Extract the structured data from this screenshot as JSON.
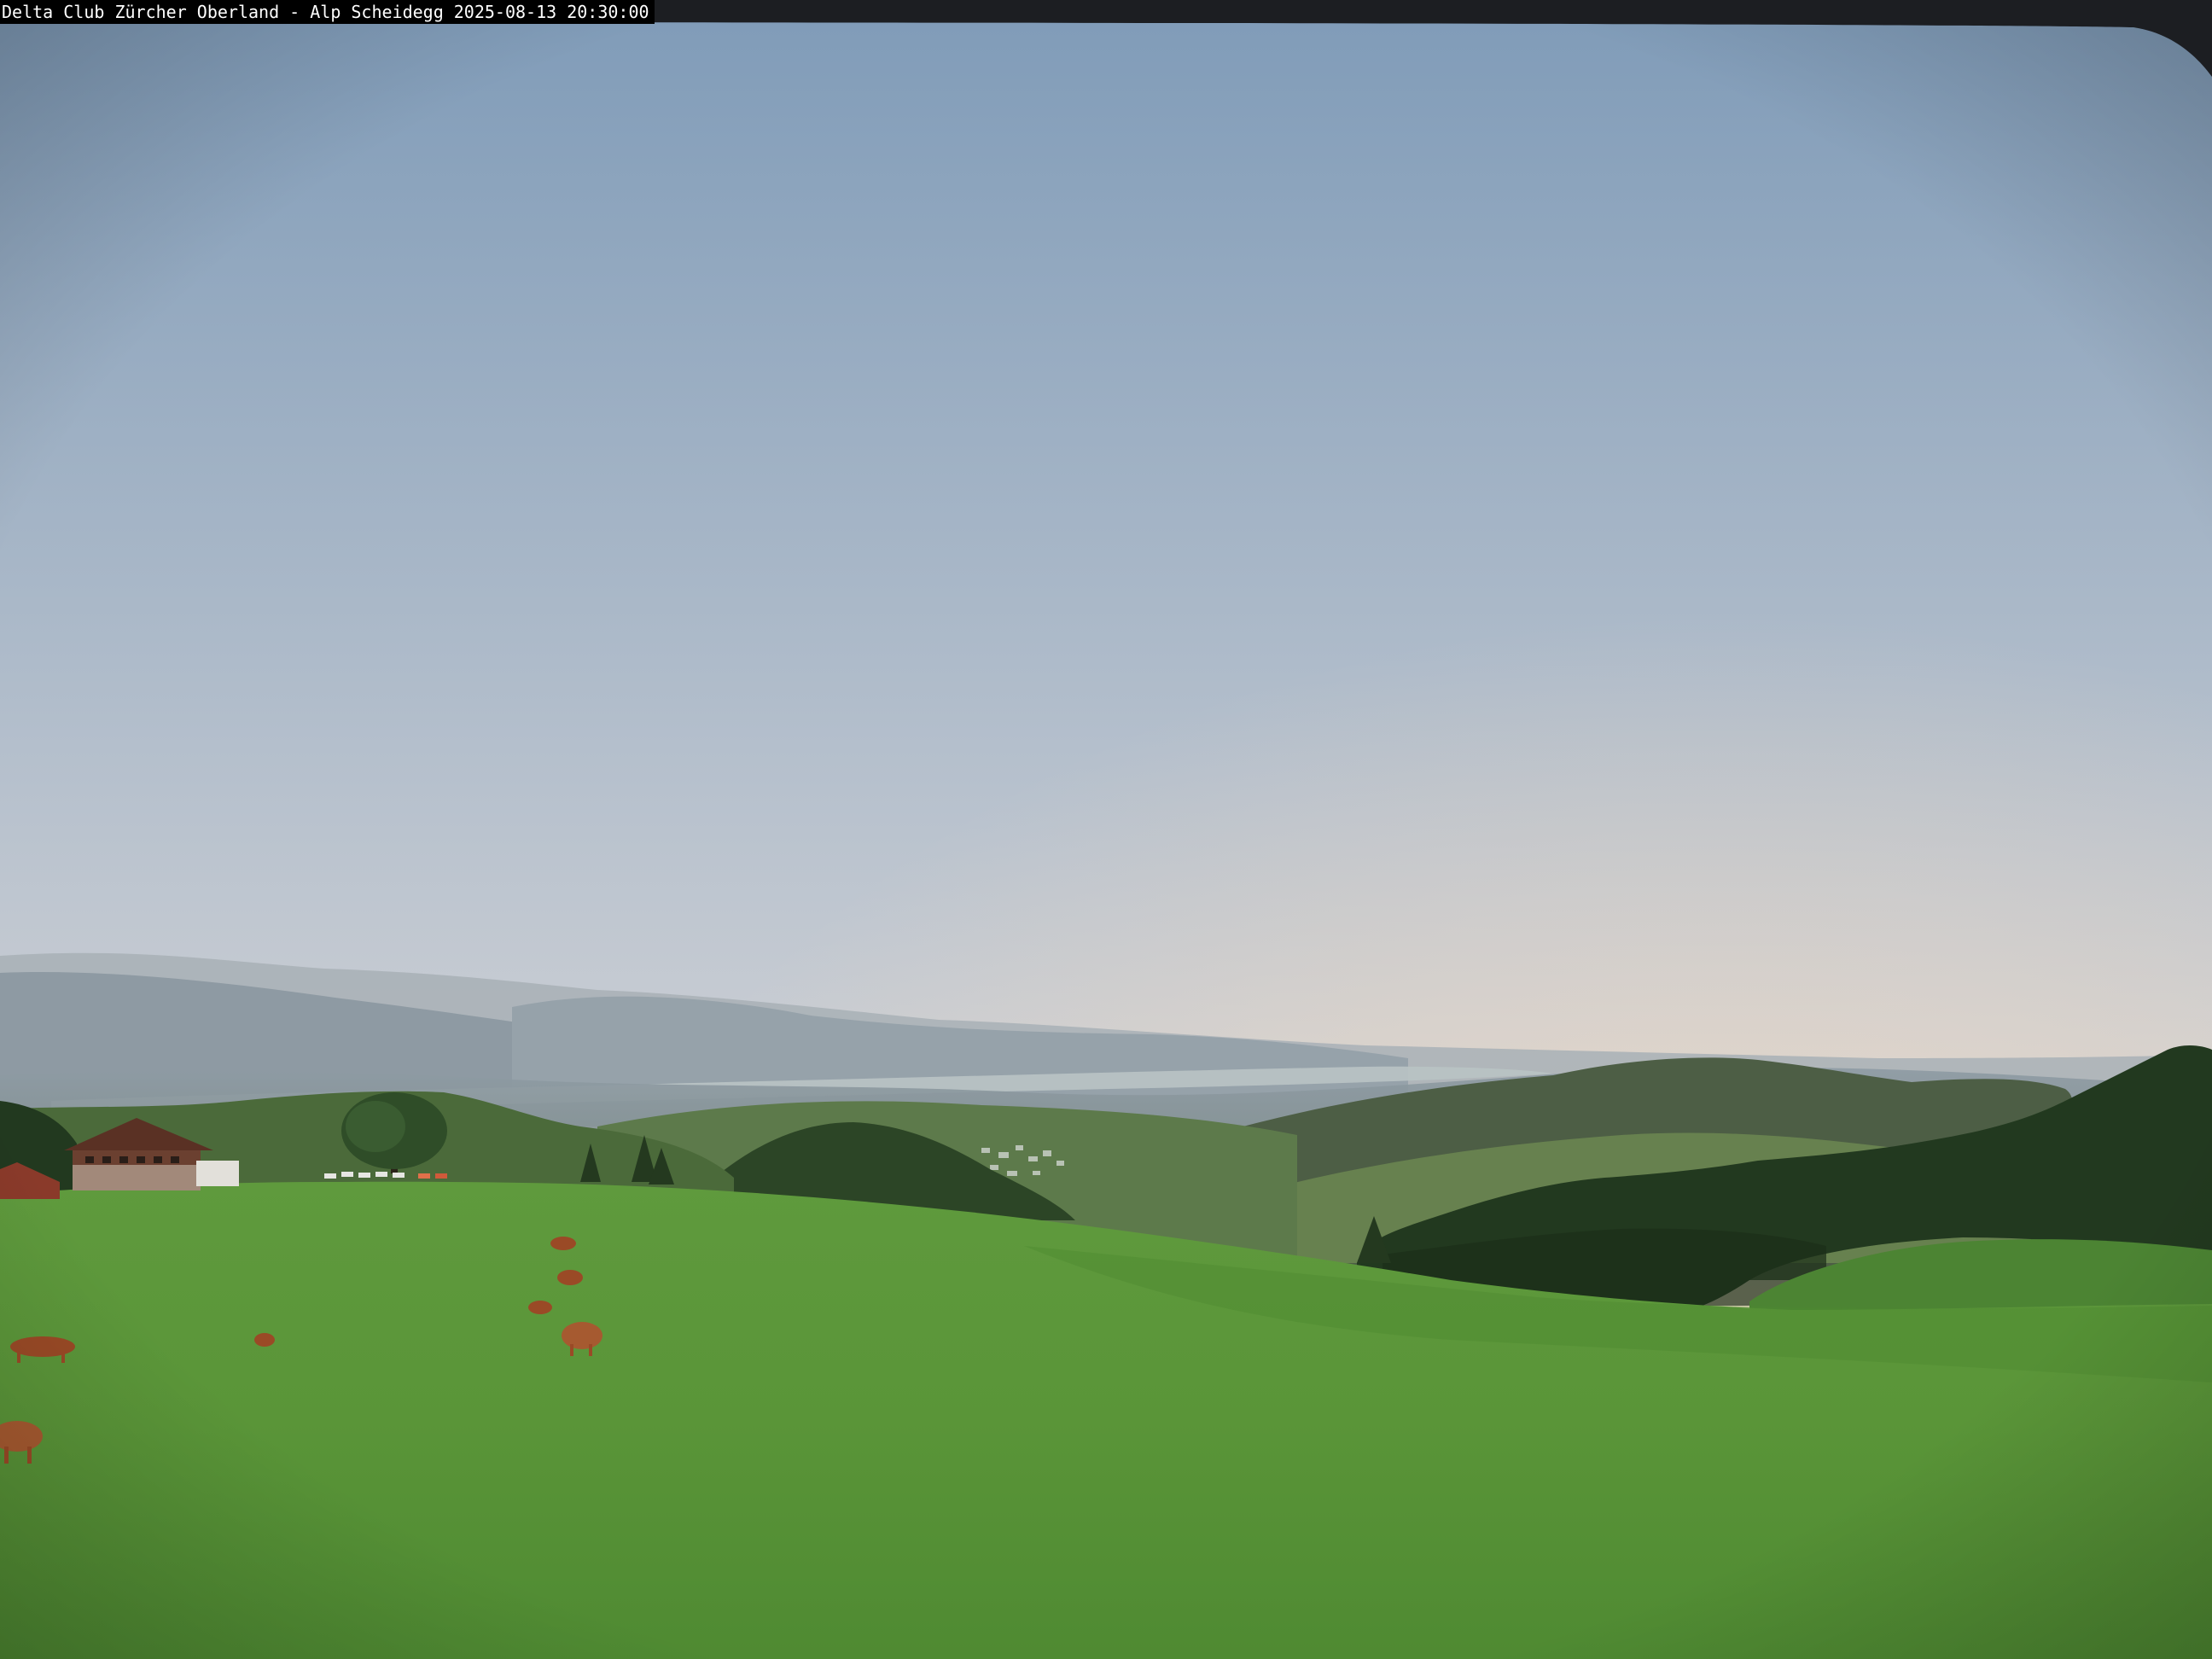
{
  "overlay": {
    "caption": "Delta Club Zürcher Oberland - Alp Scheidegg",
    "timestamp": "2025-08-13 20:30:00"
  },
  "colors": {
    "sky_top": "#7f9bb8",
    "sky_mid": "#c3cad6",
    "horizon_glow": "#f2dcc4",
    "haze": "#9aa6ad",
    "lake": "#b8c2c2",
    "meadow": "#5e9a3c",
    "meadow_dark": "#3f7428",
    "forest": "#22391f",
    "farmhouse_roof": "#5a3124",
    "cattle": "#9a4a26"
  },
  "scene": {
    "subjects": [
      "sky",
      "distant-hills",
      "lake",
      "valley-village",
      "forest",
      "meadow",
      "farmhouse",
      "cattle"
    ]
  }
}
